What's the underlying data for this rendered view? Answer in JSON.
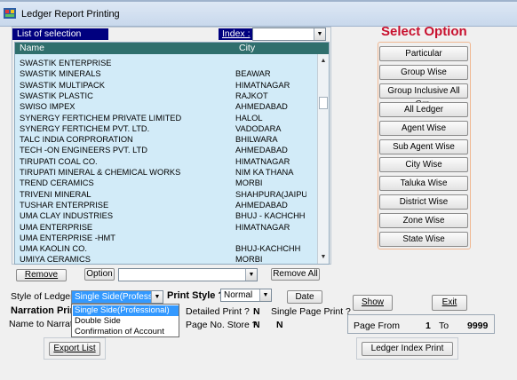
{
  "window": {
    "title": "Ledger Report Printing"
  },
  "list": {
    "label": "List of selection",
    "index_label": "Index :",
    "columns": [
      "Name",
      "City"
    ],
    "rows": [
      [
        "SWASTIK ENTERPRISE",
        ""
      ],
      [
        "SWASTIK MINERALS",
        "BEAWAR"
      ],
      [
        "SWASTIK MULTIPACK",
        "HIMATNAGAR"
      ],
      [
        "SWASTIK PLASTIC",
        "RAJKOT"
      ],
      [
        "SWISO IMPEX",
        "AHMEDABAD"
      ],
      [
        "SYNERGY FERTICHEM PRIVATE LIMITED",
        "HALOL"
      ],
      [
        "SYNERGY FERTICHEM PVT. LTD.",
        "VADODARA"
      ],
      [
        "TALC INDIA CORPRORATION",
        "BHILWARA"
      ],
      [
        "TECH -ON ENGINEERS PVT. LTD",
        "AHMEDABAD"
      ],
      [
        "TIRUPATI COAL CO.",
        "HIMATNAGAR"
      ],
      [
        "TIRUPATI MINERAL & CHEMICAL WORKS",
        "NIM KA THANA"
      ],
      [
        "TREND CERAMICS",
        "MORBI"
      ],
      [
        "TRIVENI MINERAL",
        "SHAHPURA(JAIPU"
      ],
      [
        "TUSHAR ENTERPRISE",
        "AHMEDABAD"
      ],
      [
        "UMA CLAY INDUSTRIES",
        "BHUJ - KACHCHH"
      ],
      [
        "UMA ENTERPRISE",
        "HIMATNAGAR"
      ],
      [
        "UMA ENTERPRISE -HMT",
        ""
      ],
      [
        "UMA KAOLIN CO.",
        "BHUJ-KACHCHH"
      ],
      [
        "UMIYA CERAMICS",
        "MORBI"
      ]
    ]
  },
  "list_controls": {
    "remove": "Remove",
    "option": "Option",
    "remove_all": "Remove All"
  },
  "select_option": {
    "title": "Select Option",
    "buttons": [
      "Particular",
      "Group Wise",
      "Group Inclusive All Grp.",
      "All Ledger",
      "Agent Wise",
      "Sub Agent Wise",
      "City Wise",
      "Taluka Wise",
      "District Wise",
      "Zone Wise",
      "State Wise"
    ]
  },
  "form": {
    "style_label": "Style of Ledger",
    "style_value": "Single Side(Professio",
    "style_options": [
      "Single Side(Professional)",
      "Double Side",
      "Confirmation of Account"
    ],
    "print_style_label": "Print Style ?",
    "print_style_value": "Normal",
    "date_button": "Date",
    "narration_label": "Narration Print",
    "name_to_narration_label": "Name to Narratio",
    "detailed_print_label": "Detailed Print ?",
    "detailed_print_value": "N",
    "single_page_label": "Single Page Print ?",
    "page_no_store_label": "Page No. Store ?",
    "page_no_store_value": "N",
    "show_button": "Show",
    "exit_button": "Exit",
    "page_from_label": "Page From",
    "page_from_value": "1",
    "to_label": "To",
    "to_value": "9999",
    "export_button": "Export List",
    "ledger_index_button": "Ledger Index Print"
  }
}
